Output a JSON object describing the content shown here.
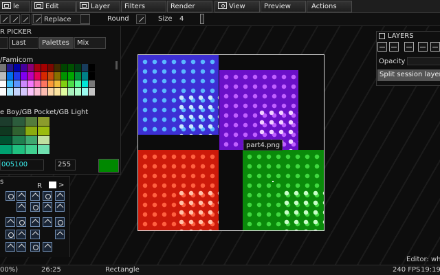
{
  "menubar": {
    "items": [
      {
        "label": "le",
        "icon": "file-icon"
      },
      {
        "label": "Edit",
        "icon": "edit-icon"
      },
      {
        "label": "Layer",
        "icon": "layer-icon"
      },
      {
        "label": "Filters",
        "icon": ""
      },
      {
        "label": "Render",
        "icon": ""
      },
      {
        "label": "View",
        "icon": "eye-icon"
      },
      {
        "label": "Preview",
        "icon": ""
      },
      {
        "label": "Actions",
        "icon": ""
      }
    ]
  },
  "toolbar": {
    "blend_mode": "Replace",
    "round_label": "Round",
    "size_label": "Size",
    "size_value": "4"
  },
  "color_picker": {
    "title": "R PICKER",
    "tabs": [
      "",
      "Last",
      "Palettes",
      "Mix"
    ],
    "active_tab": "Palettes",
    "palette1_name": "/Famicom",
    "palette2_name": "e Boy/GB Pocket/GB Light",
    "hex_value": "005100",
    "alpha_value": "255",
    "current_color": "#008800",
    "famicom_colors": [
      "#747474",
      "#24188c",
      "#0000a8",
      "#44009c",
      "#8c0074",
      "#a80010",
      "#a40000",
      "#7c0800",
      "#402c00",
      "#004400",
      "#005000",
      "#003c14",
      "#183c5c",
      "#000000",
      "#bcbcbc",
      "#0070ec",
      "#2038ec",
      "#8000f0",
      "#bc00bc",
      "#e40058",
      "#d82800",
      "#c84c0c",
      "#887000",
      "#009400",
      "#00a800",
      "#009038",
      "#008088",
      "#000000",
      "#fcfcfc",
      "#3cbcfc",
      "#5c94fc",
      "#cc88fc",
      "#f478fc",
      "#fc74b4",
      "#fc7460",
      "#fc9838",
      "#f0bc3c",
      "#80d010",
      "#4cdc48",
      "#58f898",
      "#00e8d8",
      "#787878",
      "#fcfcfc",
      "#a8e4fc",
      "#c4d4fc",
      "#d4c8fc",
      "#fcc4fc",
      "#fcc4d8",
      "#fcbcb0",
      "#fcd8a8",
      "#fce4a0",
      "#e0fca0",
      "#a8f0bc",
      "#b0fccc",
      "#9cfcf0",
      "#c4c4c4"
    ],
    "gb_colors": [
      "#1c3c2c",
      "#2c5c3c",
      "#547c3c",
      "#8c9c2c",
      "#0f3820",
      "#306230",
      "#8bac0f",
      "#9bbc0f",
      "#005030",
      "#208050",
      "#40a870",
      "#c0e0a0",
      "#00a070",
      "#20c080",
      "#40d090",
      "#70e0b0"
    ]
  },
  "tools": {
    "header": "s",
    "r_label": "R",
    "fg_color": "#ffffff"
  },
  "canvas": {
    "parts": [
      {
        "name": "blue",
        "color": "#3d2fd4",
        "dot": "#5ab8ff",
        "dot2": "#c8e8ff"
      },
      {
        "name": "purple",
        "color": "#6a10c8",
        "dot": "#c060ff",
        "dot2": "#f0d0ff"
      },
      {
        "name": "red",
        "color": "#cc1a0a",
        "dot": "#ff6040",
        "dot2": "#ffc0a8"
      },
      {
        "name": "green",
        "color": "#0a8a0a",
        "dot": "#40d840",
        "dot2": "#c8ffc8"
      }
    ],
    "tooltip": "part4.png"
  },
  "layers": {
    "title": "LAYERS",
    "opacity_label": "Opacity",
    "layer_name": "Split session layer"
  },
  "status": {
    "zoom": "00%)",
    "time": "26:25",
    "tool": "Rectangle",
    "editor": "Editor: who",
    "fps": "240 FPS",
    "clock": "19:19"
  }
}
